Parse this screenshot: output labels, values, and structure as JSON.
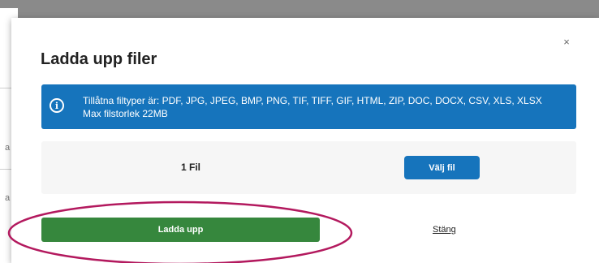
{
  "modal": {
    "title": "Ladda upp filer",
    "close_symbol": "×",
    "info": {
      "icon": "info-icon",
      "icon_glyph": "i",
      "allowed_types": "Tillåtna filtyper är: PDF, JPG, JPEG, BMP, PNG, TIF, TIFF, GIF, HTML, ZIP, DOC, DOCX, CSV, XLS, XLSX",
      "max_size": "Max filstorlek 22MB"
    },
    "file_picker": {
      "file_count": "1 Fil",
      "choose_label": "Välj fil"
    },
    "upload_label": "Ladda upp",
    "close_label": "Stäng"
  },
  "background": {
    "fragment_1": "a",
    "fragment_2": "a"
  },
  "colors": {
    "info_blue": "#1674bc",
    "upload_green": "#36873d",
    "highlight_ring": "#b3195e"
  }
}
